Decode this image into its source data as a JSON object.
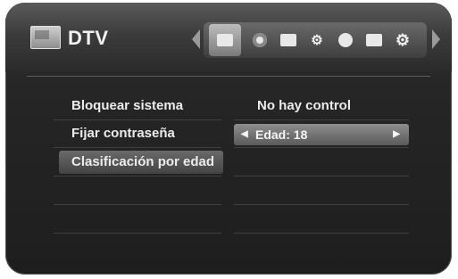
{
  "header": {
    "title": "DTV",
    "icons": [
      "tv-icon",
      "disc-icon",
      "display-icon",
      "gears-icon",
      "globe-icon",
      "folder-icon",
      "gear-icon"
    ]
  },
  "menu": {
    "items": [
      {
        "label": "Bloquear sistema"
      },
      {
        "label": "Fijar contraseña"
      },
      {
        "label": "Clasificación por edad"
      }
    ]
  },
  "settings": {
    "lock_value": "No hay control",
    "age_selector": "Edad: 18"
  },
  "glyphs": {
    "left": "◀",
    "right": "▶"
  }
}
